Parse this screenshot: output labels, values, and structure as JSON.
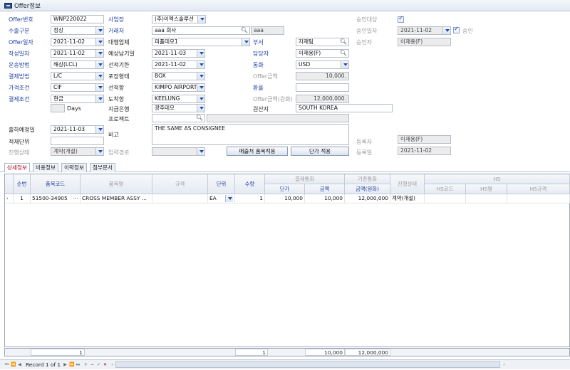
{
  "window": {
    "title": "Offer정보"
  },
  "form": {
    "offer_no_label": "Offer번호",
    "offer_no": "WNP220022",
    "export_type_label": "수출구분",
    "export_type": "정상",
    "offer_date_label": "Offer일자",
    "offer_date": "2021-11-02",
    "write_date_label": "작성일자",
    "write_date": "2021-11-02",
    "transport_label": "운송방법",
    "transport": "해상(LCL)",
    "payment_label": "결제방법",
    "payment": "L/C",
    "price_cond_label": "가격조건",
    "price_cond": "CIF",
    "settle_cond_label": "결제조건",
    "settle_cond": "현금",
    "days_label": "Days",
    "ship_plan_label": "출하예정일",
    "ship_plan": "2021-11-03",
    "load_unit_label": "적재단위",
    "progress_label": "진행상태",
    "progress": "계약(개설)",
    "biz_label": "사업장",
    "biz": "(주)이멕스솔루션",
    "client_label": "거래처",
    "client": "aaa 회사",
    "client_code": "aaa",
    "agent_label": "대행업체",
    "agent": "피플데모1",
    "expect_pay_label": "예상납기일",
    "expect_pay": "2021-11-03",
    "ship_deadline_label": "선적기한",
    "ship_deadline": "2021-11-02",
    "pack_label": "포장형태",
    "pack": "BOX",
    "ship_port_label": "선적항",
    "ship_port": "KIMPO AIRPORT",
    "arrive_port_label": "도착항",
    "arrive_port": "KEELUNG",
    "pay_bank_label": "지급은행",
    "pay_bank": "광주데모",
    "project_label": "프로젝트",
    "memo_label": "비고",
    "memo": "THE SAME AS CONSIGNEE",
    "input_path_label": "입력경로",
    "dept_label": "부서",
    "dept": "자재팀",
    "manager_label": "담당자",
    "manager": "이재용(F)",
    "currency_label": "통화",
    "currency": "USD",
    "offer_amt_label": "Offer금액",
    "offer_amt": "10,000.",
    "exch_label": "환율",
    "offer_amt_krw_label": "Offer금액(원화)",
    "offer_amt_krw": "12,000,000.",
    "origin_label": "원산지",
    "origin": "SOUTH KOREA",
    "approval_target_label": "승인대상",
    "approval_date_label": "승인일자",
    "approval_date": "2021-11-02",
    "approve_label": "승인",
    "approver_label": "승인자",
    "approver": "이재용(F)",
    "register_label": "등록자",
    "register": "이재용(F)",
    "register_date_label": "등록일",
    "register_date": "2021-11-02",
    "btn_buyer_apply": "매출처 품목적용",
    "btn_price_apply": "단가 적용"
  },
  "tabs": [
    "상세정보",
    "비용정보",
    "이력정보",
    "첨부문서"
  ],
  "grid": {
    "headers": {
      "seq": "순번",
      "item_code": "품목코드",
      "item_name": "품목명",
      "spec": "규격",
      "unit": "단위",
      "qty": "수량",
      "settle_cur": "결제통화",
      "unit_price": "단가",
      "amount": "금액",
      "base_cur": "기준통화",
      "amount_krw": "금액(원화)",
      "status": "진행상태",
      "hs": "HS",
      "hs_code": "HS코드",
      "hs_name": "HS명",
      "hs_spec": "HS규격"
    },
    "rows": [
      {
        "seq": "1",
        "item_code": "51500-34905",
        "item_name": "CROSS MEMBER ASSY ...",
        "spec": "",
        "unit": "EA",
        "qty": "1",
        "unit_price": "10,000",
        "amount": "10,000",
        "amount_krw": "12,000,000",
        "status": "계약(개설)"
      }
    ],
    "footer": {
      "count": "1",
      "qty": "1",
      "amount": "10,000",
      "amount_krw": "12,000,000"
    }
  },
  "nav": {
    "record": "Record 1 of 1"
  }
}
